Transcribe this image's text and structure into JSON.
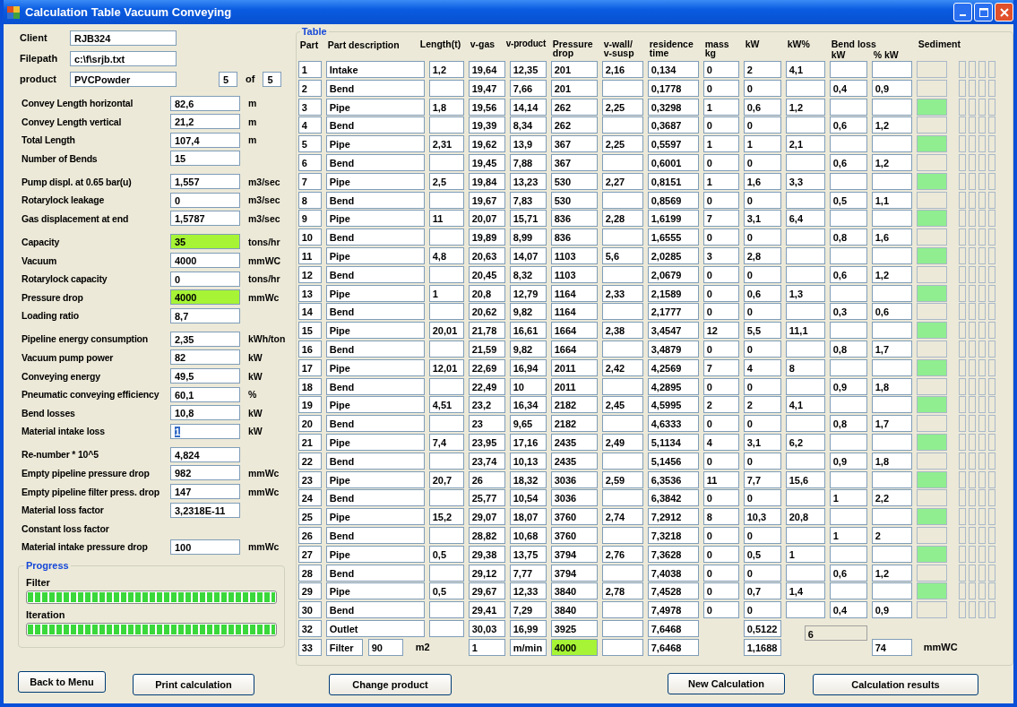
{
  "window": {
    "title": "Calculation Table Vacuum Conveying"
  },
  "header_fields": {
    "client": {
      "label": "Client",
      "value": "RJB324"
    },
    "filepath": {
      "label": "Filepath",
      "value": "c:\\f\\srjb.txt"
    },
    "product": {
      "label": "product",
      "value": "PVCPowder",
      "index": "5",
      "of_label": "of",
      "total": "5"
    }
  },
  "parameter_groups": [
    [
      {
        "label": "Convey Length horizontal",
        "value": "82,6",
        "unit": "m",
        "highlighted": false,
        "text_selected": false
      },
      {
        "label": "Convey Length vertical",
        "value": "21,2",
        "unit": "m",
        "highlighted": false,
        "text_selected": false
      },
      {
        "label": "Total Length",
        "value": "107,4",
        "unit": "m",
        "highlighted": false,
        "text_selected": false
      },
      {
        "label": "Number of Bends",
        "value": "15",
        "highlighted": false,
        "text_selected": false
      }
    ],
    [
      {
        "label": "Pump displ. at 0.65 bar(u)",
        "value": "1,557",
        "unit": "m3/sec",
        "highlighted": false,
        "text_selected": false
      },
      {
        "label": "Rotarylock leakage",
        "value": "0",
        "unit": "m3/sec",
        "highlighted": false,
        "text_selected": false
      },
      {
        "label": "Gas displacement at end",
        "value": "1,5787",
        "unit": "m3/sec",
        "highlighted": false,
        "text_selected": false
      }
    ],
    [
      {
        "label": "Capacity",
        "value": "35",
        "unit": "tons/hr",
        "highlighted": true,
        "text_selected": false
      },
      {
        "label": "Vacuum",
        "value": "4000",
        "unit": "mmWC",
        "highlighted": false,
        "text_selected": false
      },
      {
        "label": "Rotarylock capacity",
        "value": "0",
        "unit": "tons/hr",
        "highlighted": false,
        "text_selected": false
      },
      {
        "label": "Pressure drop",
        "value": "4000",
        "unit": "mmWc",
        "highlighted": true,
        "text_selected": false
      },
      {
        "label": "Loading ratio",
        "value": "8,7",
        "highlighted": false,
        "text_selected": false
      }
    ],
    [
      {
        "label": "Pipeline energy consumption",
        "value": "2,35",
        "unit": "kWh/ton",
        "highlighted": false,
        "text_selected": false
      },
      {
        "label": "Vacuum pump power",
        "value": "82",
        "unit": "kW",
        "highlighted": false,
        "text_selected": false
      },
      {
        "label": "Conveying energy",
        "value": "49,5",
        "unit": "kW",
        "highlighted": false,
        "text_selected": false
      },
      {
        "label": "Pneumatic conveying efficiency",
        "value": "60,1",
        "unit": "%",
        "highlighted": false,
        "text_selected": false
      },
      {
        "label": "Bend losses",
        "value": "10,8",
        "unit": "kW",
        "highlighted": false,
        "text_selected": false
      },
      {
        "label": "Material intake loss",
        "value": "1",
        "unit": "kW",
        "highlighted": false,
        "text_selected": true
      }
    ],
    [
      {
        "label": "Re-number * 10^5",
        "value": "4,824",
        "highlighted": false,
        "text_selected": false
      },
      {
        "label": "Empty pipeline pressure drop",
        "value": "982",
        "unit": "mmWc",
        "highlighted": false,
        "text_selected": false
      },
      {
        "label": "Empty pipeline filter press. drop",
        "value": "147",
        "unit": "mmWc",
        "highlighted": false,
        "text_selected": false
      },
      {
        "label": "Material loss factor",
        "value": "3,2318E-11",
        "highlighted": false,
        "text_selected": false
      },
      {
        "label": "Constant loss factor"
      },
      {
        "label": "Material intake pressure drop",
        "value": "100",
        "unit": "mmWc",
        "highlighted": false,
        "text_selected": false
      }
    ]
  ],
  "progress": {
    "title": "Progress",
    "bars": [
      {
        "label": "Filter",
        "level": 1
      },
      {
        "label": "Iteration",
        "level": 1
      }
    ]
  },
  "table": {
    "title": "Table",
    "columns": [
      "Part",
      "Part description",
      "Length(t)",
      "v-gas",
      "v-product",
      "Pressure drop",
      "v-wall/ v-susp",
      "residence time",
      "mass kg",
      "kW",
      "kW%",
      "kW",
      "% kW",
      "Sediment"
    ],
    "bend_loss_label": "Bend loss",
    "rows": [
      {
        "part": "1",
        "description": "Intake",
        "length": "1,2",
        "v_gas": "19,64",
        "v_product": "12,35",
        "pressure_drop": "201",
        "v_wall": "2,16",
        "residence_time": "0,134",
        "mass": "0",
        "kw": "2",
        "kw_pct": "4,1",
        "sediment": false
      },
      {
        "part": "2",
        "description": "Bend",
        "v_gas": "19,47",
        "v_product": "7,66",
        "pressure_drop": "201",
        "residence_time": "0,1778",
        "mass": "0",
        "kw": "0",
        "bend_kw": "0,4",
        "bend_pct": "0,9",
        "sediment": false
      },
      {
        "part": "3",
        "description": "Pipe",
        "length": "1,8",
        "v_gas": "19,56",
        "v_product": "14,14",
        "pressure_drop": "262",
        "v_wall": "2,25",
        "residence_time": "0,3298",
        "mass": "1",
        "kw": "0,6",
        "kw_pct": "1,2",
        "sediment": true
      },
      {
        "part": "4",
        "description": "Bend",
        "v_gas": "19,39",
        "v_product": "8,34",
        "pressure_drop": "262",
        "residence_time": "0,3687",
        "mass": "0",
        "kw": "0",
        "bend_kw": "0,6",
        "bend_pct": "1,2",
        "sediment": false
      },
      {
        "part": "5",
        "description": "Pipe",
        "length": "2,31",
        "v_gas": "19,62",
        "v_product": "13,9",
        "pressure_drop": "367",
        "v_wall": "2,25",
        "residence_time": "0,5597",
        "mass": "1",
        "kw": "1",
        "kw_pct": "2,1",
        "sediment": true
      },
      {
        "part": "6",
        "description": "Bend",
        "v_gas": "19,45",
        "v_product": "7,88",
        "pressure_drop": "367",
        "residence_time": "0,6001",
        "mass": "0",
        "kw": "0",
        "bend_kw": "0,6",
        "bend_pct": "1,2",
        "sediment": false
      },
      {
        "part": "7",
        "description": "Pipe",
        "length": "2,5",
        "v_gas": "19,84",
        "v_product": "13,23",
        "pressure_drop": "530",
        "v_wall": "2,27",
        "residence_time": "0,8151",
        "mass": "1",
        "kw": "1,6",
        "kw_pct": "3,3",
        "sediment": true
      },
      {
        "part": "8",
        "description": "Bend",
        "v_gas": "19,67",
        "v_product": "7,83",
        "pressure_drop": "530",
        "residence_time": "0,8569",
        "mass": "0",
        "kw": "0",
        "bend_kw": "0,5",
        "bend_pct": "1,1",
        "sediment": false
      },
      {
        "part": "9",
        "description": "Pipe",
        "length": "11",
        "v_gas": "20,07",
        "v_product": "15,71",
        "pressure_drop": "836",
        "v_wall": "2,28",
        "residence_time": "1,6199",
        "mass": "7",
        "kw": "3,1",
        "kw_pct": "6,4",
        "sediment": true
      },
      {
        "part": "10",
        "description": "Bend",
        "v_gas": "19,89",
        "v_product": "8,99",
        "pressure_drop": "836",
        "residence_time": "1,6555",
        "mass": "0",
        "kw": "0",
        "bend_kw": "0,8",
        "bend_pct": "1,6",
        "sediment": false
      },
      {
        "part": "11",
        "description": "Pipe",
        "length": "4,8",
        "v_gas": "20,63",
        "v_product": "14,07",
        "pressure_drop": "1103",
        "v_wall": "5,6",
        "residence_time": "2,0285",
        "mass": "3",
        "kw": "2,8",
        "sediment": true
      },
      {
        "part": "12",
        "description": "Bend",
        "v_gas": "20,45",
        "v_product": "8,32",
        "pressure_drop": "1103",
        "residence_time": "2,0679",
        "mass": "0",
        "kw": "0",
        "bend_kw": "0,6",
        "bend_pct": "1,2",
        "sediment": false
      },
      {
        "part": "13",
        "description": "Pipe",
        "length": "1",
        "v_gas": "20,8",
        "v_product": "12,79",
        "pressure_drop": "1164",
        "v_wall": "2,33",
        "residence_time": "2,1589",
        "mass": "0",
        "kw": "0,6",
        "kw_pct": "1,3",
        "sediment": true
      },
      {
        "part": "14",
        "description": "Bend",
        "v_gas": "20,62",
        "v_product": "9,82",
        "pressure_drop": "1164",
        "residence_time": "2,1777",
        "mass": "0",
        "kw": "0",
        "bend_kw": "0,3",
        "bend_pct": "0,6",
        "sediment": false
      },
      {
        "part": "15",
        "description": "Pipe",
        "length": "20,01",
        "v_gas": "21,78",
        "v_product": "16,61",
        "pressure_drop": "1664",
        "v_wall": "2,38",
        "residence_time": "3,4547",
        "mass": "12",
        "kw": "5,5",
        "kw_pct": "11,1",
        "sediment": true
      },
      {
        "part": "16",
        "description": "Bend",
        "v_gas": "21,59",
        "v_product": "9,82",
        "pressure_drop": "1664",
        "residence_time": "3,4879",
        "mass": "0",
        "kw": "0",
        "bend_kw": "0,8",
        "bend_pct": "1,7",
        "sediment": false
      },
      {
        "part": "17",
        "description": "Pipe",
        "length": "12,01",
        "v_gas": "22,69",
        "v_product": "16,94",
        "pressure_drop": "2011",
        "v_wall": "2,42",
        "residence_time": "4,2569",
        "mass": "7",
        "kw": "4",
        "kw_pct": "8",
        "sediment": true
      },
      {
        "part": "18",
        "description": "Bend",
        "v_gas": "22,49",
        "v_product": "10",
        "pressure_drop": "2011",
        "residence_time": "4,2895",
        "mass": "0",
        "kw": "0",
        "bend_kw": "0,9",
        "bend_pct": "1,8",
        "sediment": false
      },
      {
        "part": "19",
        "description": "Pipe",
        "length": "4,51",
        "v_gas": "23,2",
        "v_product": "16,34",
        "pressure_drop": "2182",
        "v_wall": "2,45",
        "residence_time": "4,5995",
        "mass": "2",
        "kw": "2",
        "kw_pct": "4,1",
        "sediment": true
      },
      {
        "part": "20",
        "description": "Bend",
        "v_gas": "23",
        "v_product": "9,65",
        "pressure_drop": "2182",
        "residence_time": "4,6333",
        "mass": "0",
        "kw": "0",
        "bend_kw": "0,8",
        "bend_pct": "1,7",
        "sediment": false
      },
      {
        "part": "21",
        "description": "Pipe",
        "length": "7,4",
        "v_gas": "23,95",
        "v_product": "17,16",
        "pressure_drop": "2435",
        "v_wall": "2,49",
        "residence_time": "5,1134",
        "mass": "4",
        "kw": "3,1",
        "kw_pct": "6,2",
        "sediment": true
      },
      {
        "part": "22",
        "description": "Bend",
        "v_gas": "23,74",
        "v_product": "10,13",
        "pressure_drop": "2435",
        "residence_time": "5,1456",
        "mass": "0",
        "kw": "0",
        "bend_kw": "0,9",
        "bend_pct": "1,8",
        "sediment": false
      },
      {
        "part": "23",
        "description": "Pipe",
        "length": "20,7",
        "v_gas": "26",
        "v_product": "18,32",
        "pressure_drop": "3036",
        "v_wall": "2,59",
        "residence_time": "6,3536",
        "mass": "11",
        "kw": "7,7",
        "kw_pct": "15,6",
        "sediment": true
      },
      {
        "part": "24",
        "description": "Bend",
        "v_gas": "25,77",
        "v_product": "10,54",
        "pressure_drop": "3036",
        "residence_time": "6,3842",
        "mass": "0",
        "kw": "0",
        "bend_kw": "1",
        "bend_pct": "2,2",
        "sediment": false
      },
      {
        "part": "25",
        "description": "Pipe",
        "length": "15,2",
        "v_gas": "29,07",
        "v_product": "18,07",
        "pressure_drop": "3760",
        "v_wall": "2,74",
        "residence_time": "7,2912",
        "mass": "8",
        "kw": "10,3",
        "kw_pct": "20,8",
        "sediment": true
      },
      {
        "part": "26",
        "description": "Bend",
        "v_gas": "28,82",
        "v_product": "10,68",
        "pressure_drop": "3760",
        "residence_time": "7,3218",
        "mass": "0",
        "kw": "0",
        "bend_kw": "1",
        "bend_pct": "2",
        "sediment": false
      },
      {
        "part": "27",
        "description": "Pipe",
        "length": "0,5",
        "v_gas": "29,38",
        "v_product": "13,75",
        "pressure_drop": "3794",
        "v_wall": "2,76",
        "residence_time": "7,3628",
        "mass": "0",
        "kw": "0,5",
        "kw_pct": "1",
        "sediment": true
      },
      {
        "part": "28",
        "description": "Bend",
        "v_gas": "29,12",
        "v_product": "7,77",
        "pressure_drop": "3794",
        "residence_time": "7,4038",
        "mass": "0",
        "kw": "0",
        "bend_kw": "0,6",
        "bend_pct": "1,2",
        "sediment": false
      },
      {
        "part": "29",
        "description": "Pipe",
        "length": "0,5",
        "v_gas": "29,67",
        "v_product": "12,33",
        "pressure_drop": "3840",
        "v_wall": "2,78",
        "residence_time": "7,4528",
        "mass": "0",
        "kw": "0,7",
        "kw_pct": "1,4",
        "sediment": true
      },
      {
        "part": "30",
        "description": "Bend",
        "v_gas": "29,41",
        "v_product": "7,29",
        "pressure_drop": "3840",
        "residence_time": "7,4978",
        "mass": "0",
        "kw": "0",
        "bend_kw": "0,4",
        "bend_pct": "0,9",
        "sediment": false
      }
    ],
    "outlet_row": {
      "part": "32",
      "description": "Outlet",
      "v_gas": "30,03",
      "v_product": "16,99",
      "pressure_drop": "3925",
      "residence_time": "7,6468",
      "kw": "0,5122",
      "field_6": "6"
    },
    "filter_row": {
      "part": "33",
      "description": "Filter",
      "area": "90",
      "area_unit": "m2",
      "v_gas": "1",
      "v_product": "m/min",
      "pressure_drop": "4000",
      "pressure_drop_highlighted": true,
      "residence_time": "7,6468",
      "kw": "1,1688",
      "filter_drop": "74",
      "filter_drop_unit": "mmWC"
    }
  },
  "buttons": [
    "Back to Menu",
    "Print calculation",
    "Change product",
    "New Calculation",
    "Calculation results"
  ]
}
